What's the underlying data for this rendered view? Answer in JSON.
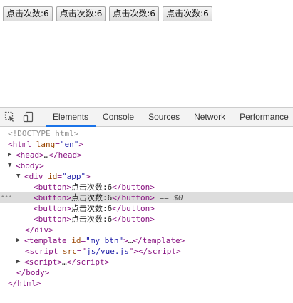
{
  "buttons": [
    {
      "label": "点击次数:6"
    },
    {
      "label": "点击次数:6"
    },
    {
      "label": "点击次数:6"
    },
    {
      "label": "点击次数:6"
    }
  ],
  "devtools": {
    "tabs": [
      "Elements",
      "Console",
      "Sources",
      "Network",
      "Performance"
    ],
    "active_tab": "Elements",
    "dom": {
      "doctype": "<!DOCTYPE html>",
      "html_open": "<html",
      "html_attr_name": "lang",
      "html_attr_value": "\"en\"",
      "head": "head",
      "head_collapsed": "…",
      "body": "body",
      "div": "div",
      "div_attr_name": "id",
      "div_attr_value": "\"app\"",
      "button_tag": "button",
      "button_text": "点击次数:6",
      "selected_marker": "== $0",
      "template_tag": "template",
      "template_attr_name": "id",
      "template_attr_value": "\"my_btn\"",
      "script_tag": "script",
      "script_attr_name": "src",
      "script_attr_value": "js/vue.js",
      "ellipsis": "…"
    }
  },
  "colors": {
    "tag": "#881280",
    "attr_name": "#994500",
    "attr_value": "#1a1aa6",
    "active_tab_underline": "#1a73e8",
    "selected_row": "#dddddd"
  }
}
